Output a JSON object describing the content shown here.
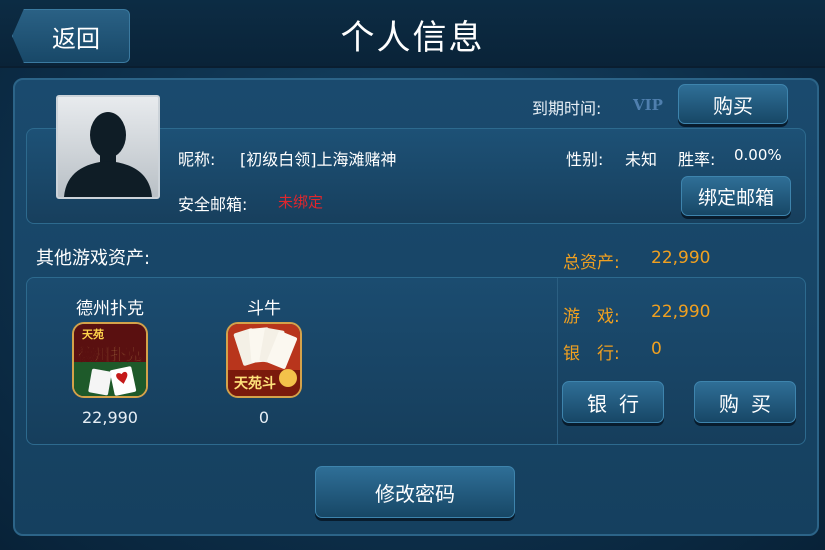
{
  "header": {
    "back_label": "返回",
    "title": "个人信息"
  },
  "account": {
    "expire_label": "到期时间:",
    "vip_badge": "VIP",
    "buy_label": "购买"
  },
  "profile": {
    "nickname_label": "昵称:",
    "nickname_value": "[初级白领]上海滩赌神",
    "email_label": "安全邮箱:",
    "email_value": "未绑定",
    "gender_label": "性别:",
    "gender_value": "未知",
    "winrate_label": "胜率:",
    "winrate_value": "0.00%",
    "bind_email_label": "绑定邮箱"
  },
  "assets": {
    "other_label": "其他游戏资产:",
    "total_label": "总资产:",
    "total_value": "22,990",
    "games": [
      {
        "name": "德州扑克",
        "icon": "texas-holdem-icon",
        "icon_text_top": "天苑",
        "icon_text_main": "德州扑克",
        "value": "22,990"
      },
      {
        "name": "斗牛",
        "icon": "douniu-icon",
        "icon_text_main": "天苑斗",
        "value": "0"
      }
    ],
    "game_label": "游　戏:",
    "game_value": "22,990",
    "bank_label": "银　行:",
    "bank_value": "0",
    "bank_button": "银行",
    "buy_button": "购买"
  },
  "footer": {
    "change_password_label": "修改密码"
  },
  "colors": {
    "accent_gold": "#f0a020",
    "warning_red": "#e0262c",
    "panel_blue": "#1a4a6e"
  }
}
